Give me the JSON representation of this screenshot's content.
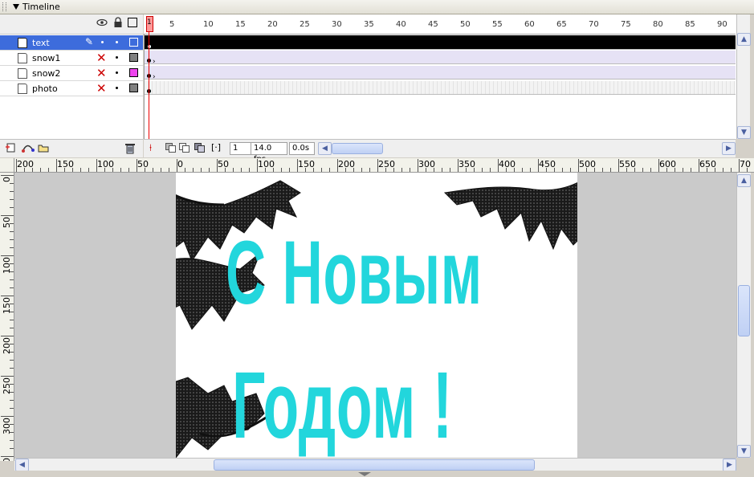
{
  "panel": {
    "title": "Timeline"
  },
  "layers": [
    {
      "name": "text",
      "selected": true,
      "swatch": "#3d6cdc"
    },
    {
      "name": "snow1",
      "selected": false,
      "swatch": "#808080"
    },
    {
      "name": "snow2",
      "selected": false,
      "swatch": "#ee44ee"
    },
    {
      "name": "photo",
      "selected": false,
      "swatch": "#808080"
    }
  ],
  "frame_ruler": [
    "1",
    "5",
    "10",
    "15",
    "20",
    "25",
    "30",
    "35",
    "40",
    "45",
    "50",
    "55",
    "60",
    "65",
    "70",
    "75",
    "80",
    "85",
    "90"
  ],
  "status": {
    "current_frame": "1",
    "fps": "14.0 fps",
    "time": "0.0s"
  },
  "h_ruler": [
    "200",
    "150",
    "100",
    "50",
    "0",
    "50",
    "100",
    "150",
    "200",
    "250",
    "300",
    "350",
    "400",
    "450",
    "500",
    "550",
    "600",
    "650",
    "70"
  ],
  "v_ruler": [
    "0",
    "50",
    "100",
    "150",
    "200",
    "250",
    "300",
    "350"
  ],
  "canvas": {
    "line1": "С Новым",
    "line2": "Годом !",
    "text_color": "#22d6dc",
    "branch_color": "#1a1a1a"
  },
  "icons": {
    "collapse": "triangle-down",
    "eye": "eye-icon",
    "lock": "lock-icon",
    "outline": "outline-square-icon",
    "add_layer": "insert-layer-icon",
    "add_guide": "add-motion-guide-icon",
    "add_folder": "insert-folder-icon",
    "delete": "trash-icon"
  }
}
